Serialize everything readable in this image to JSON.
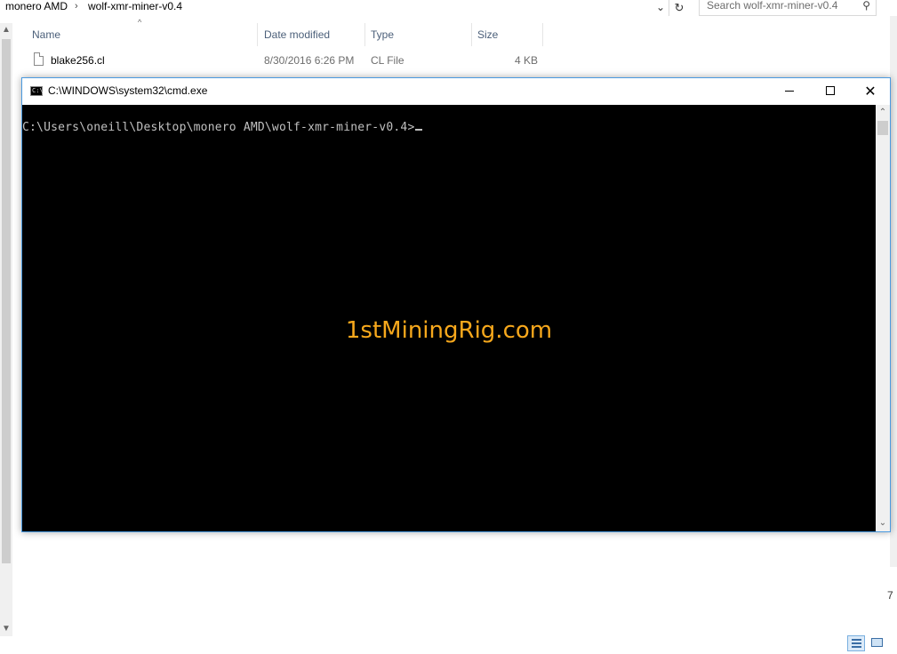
{
  "explorer": {
    "breadcrumb": [
      "monero AMD",
      "wolf-xmr-miner-v0.4"
    ],
    "search_placeholder": "Search wolf-xmr-miner-v0.4",
    "columns": [
      "Name",
      "Date modified",
      "Type",
      "Size"
    ],
    "files": [
      {
        "name": "blake256.cl",
        "date": "8/30/2016 6:26 PM",
        "type": "CL File",
        "size": "4 KB"
      }
    ],
    "right_fragment": "7"
  },
  "cmd": {
    "title": "C:\\WINDOWS\\system32\\cmd.exe",
    "prompt": "C:\\Users\\oneill\\Desktop\\monero AMD\\wolf-xmr-miner-v0.4>",
    "watermark": "1stMiningRig.com",
    "icon_glyph": "C:\\"
  },
  "colors": {
    "watermark": "#f7a81c",
    "console_bg": "#000000",
    "console_text": "#c0c0c0",
    "window_border": "#4a9ae0",
    "column_header": "#4c607a"
  }
}
